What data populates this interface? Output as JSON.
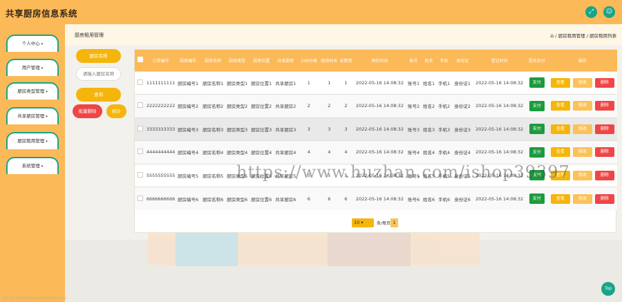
{
  "app": {
    "title": "共享厨房信息系统"
  },
  "header_icons": [
    "fullscreen-icon",
    "user-icon"
  ],
  "sidebar": {
    "items": [
      {
        "label": "个人中心"
      },
      {
        "label": "用户管理"
      },
      {
        "label": "厨房类型管理"
      },
      {
        "label": "共享厨房管理"
      },
      {
        "label": "厨房租用管理"
      },
      {
        "label": "系统管理"
      }
    ]
  },
  "page": {
    "heading": "厨房租用管理",
    "breadcrumb": "/ 厨房租用管理 / 厨房租用列表"
  },
  "search": {
    "name_label": "厨房名称",
    "placeholder": "请输入厨房名称",
    "search_button": "查询",
    "batch_delete_button": "批量删除",
    "stats_button": "统计"
  },
  "table": {
    "headers": [
      "订单编号",
      "厨房编号",
      "厨房名称",
      "厨房类型",
      "厨房位置",
      "共享厨房",
      "小时价格",
      "租用时长",
      "总费用",
      "预约时间",
      "账号",
      "姓名",
      "手机",
      "身份证",
      "登记时间",
      "是否支付",
      "操作"
    ],
    "rows": [
      [
        "1111111111",
        "厨房编号1",
        "厨房名称1",
        "厨房类型1",
        "厨房位置1",
        "共享厨房1",
        "1",
        "1",
        "1",
        "2022-05-16 14:08:32",
        "账号1",
        "姓名1",
        "手机1",
        "身份证1",
        "2022-05-16 14:08:32"
      ],
      [
        "2222222222",
        "厨房编号2",
        "厨房名称2",
        "厨房类型2",
        "厨房位置2",
        "共享厨房2",
        "2",
        "2",
        "2",
        "2022-05-16 14:08:32",
        "账号2",
        "姓名2",
        "手机2",
        "身份证2",
        "2022-05-16 14:08:32"
      ],
      [
        "3333333333",
        "厨房编号3",
        "厨房名称3",
        "厨房类型3",
        "厨房位置3",
        "共享厨房3",
        "3",
        "3",
        "3",
        "2022-05-16 14:08:32",
        "账号3",
        "姓名3",
        "手机3",
        "身份证3",
        "2022-05-16 14:08:32"
      ],
      [
        "4444444444",
        "厨房编号4",
        "厨房名称4",
        "厨房类型4",
        "厨房位置4",
        "共享厨房4",
        "4",
        "4",
        "4",
        "2022-05-16 14:08:32",
        "账号4",
        "姓名4",
        "手机4",
        "身份证4",
        "2022-05-16 14:08:32"
      ],
      [
        "5555555555",
        "厨房编号5",
        "厨房名称5",
        "厨房类型5",
        "厨房位置5",
        "共享厨房5",
        "5",
        "5",
        "5",
        "2022-05-16 14:08:32",
        "账号5",
        "姓名5",
        "手机5",
        "身份证5",
        "2022-05-16 14:08:32"
      ],
      [
        "6666666666",
        "厨房编号6",
        "厨房名称6",
        "厨房类型6",
        "厨房位置6",
        "共享厨房6",
        "6",
        "6",
        "6",
        "2022-05-16 14:08:32",
        "账号6",
        "姓名6",
        "手机6",
        "身份证6",
        "2022-05-16 14:08:32"
      ]
    ],
    "pay_label": "支付",
    "view_label": "查看",
    "edit_label": "修改",
    "delete_label": "删除"
  },
  "pagination": {
    "page_size": "10",
    "goto_label": "条/每页",
    "current_page": "1"
  },
  "watermark": "https://www.huzhan.com/ishop39397",
  "status_url": "127.0.0.1:8080/kitchen/front/list.html",
  "back_to_top": "Top",
  "colors": {
    "primary": "#fcb957",
    "accent": "#17a589",
    "danger": "#ef4545",
    "pay": "#1b9b3d"
  }
}
